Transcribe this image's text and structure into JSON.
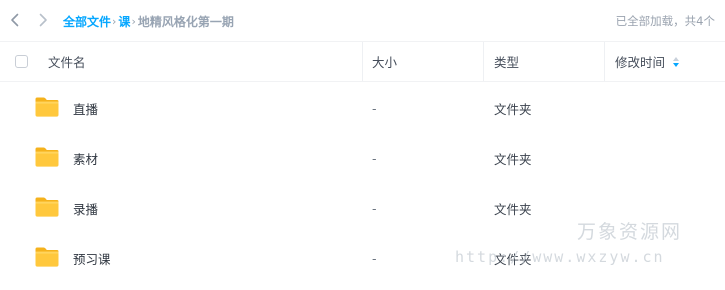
{
  "nav": {
    "back_icon": "chevron-left-icon",
    "forward_icon": "chevron-right-icon"
  },
  "breadcrumb": {
    "root": "全部文件",
    "separator": "›",
    "level1": "课",
    "current": "地精风格化第一期"
  },
  "status": {
    "loaded_text": "已全部加载，共4个"
  },
  "table": {
    "headers": {
      "name": "文件名",
      "size": "大小",
      "type": "类型",
      "mtime": "修改时间"
    },
    "sort_icon": "sort-arrows-icon",
    "rows": [
      {
        "name": "直播",
        "size": "-",
        "type": "文件夹",
        "mtime": "",
        "icon": "folder-icon"
      },
      {
        "name": "素材",
        "size": "-",
        "type": "文件夹",
        "mtime": "",
        "icon": "folder-icon"
      },
      {
        "name": "录播",
        "size": "-",
        "type": "文件夹",
        "mtime": "",
        "icon": "folder-icon"
      },
      {
        "name": "预习课",
        "size": "-",
        "type": "文件夹",
        "mtime": "",
        "icon": "folder-icon"
      }
    ]
  },
  "watermark": {
    "title": "万象资源网",
    "url": "http://www.wxzyw.cn"
  },
  "colors": {
    "accent": "#06a7ff",
    "breadcrumb_current": "#98a4b3",
    "folder_body": "#ffc83d",
    "folder_tab": "#f5b21c",
    "sort_active": "#06a7ff"
  }
}
